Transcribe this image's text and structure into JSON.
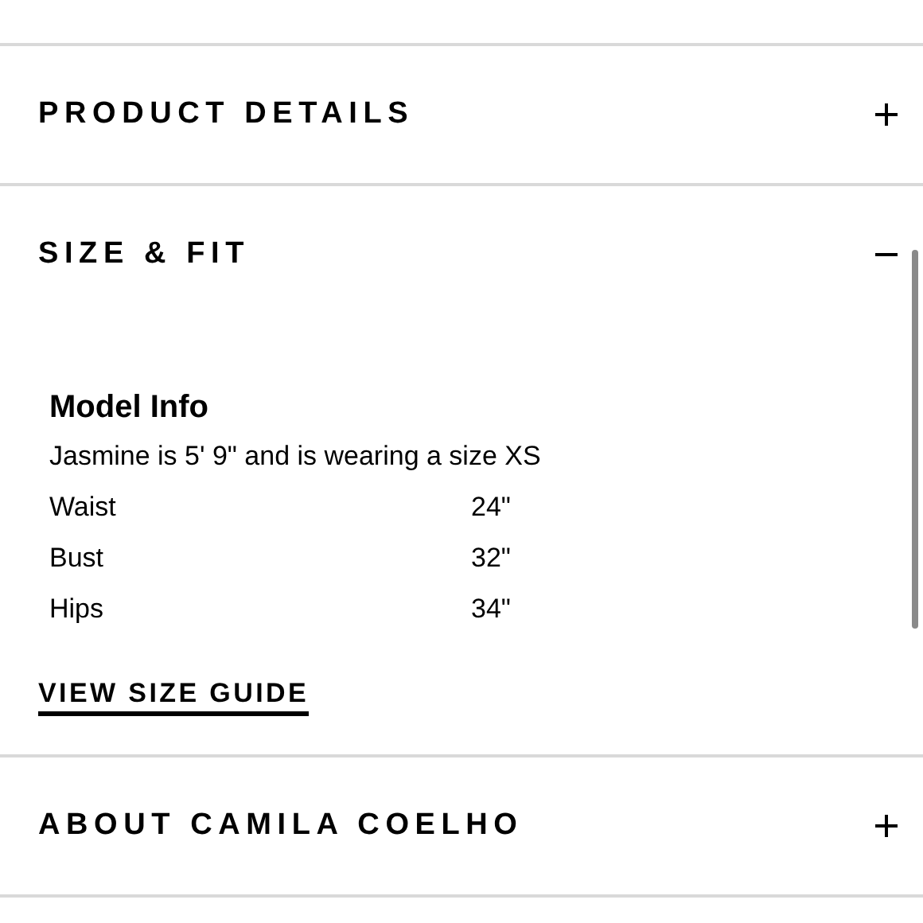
{
  "sections": [
    {
      "title": "PRODUCT DETAILS",
      "expanded": false
    },
    {
      "title": "SIZE & FIT",
      "expanded": true,
      "content": {
        "heading": "Model Info",
        "description": "Jasmine is 5' 9\" and is wearing a size XS",
        "measurements": [
          {
            "label": "Waist",
            "value": "24\""
          },
          {
            "label": "Bust",
            "value": "32\""
          },
          {
            "label": "Hips",
            "value": "34\""
          }
        ],
        "link": "VIEW SIZE GUIDE"
      }
    },
    {
      "title": "ABOUT CAMILA COELHO",
      "expanded": false
    }
  ]
}
